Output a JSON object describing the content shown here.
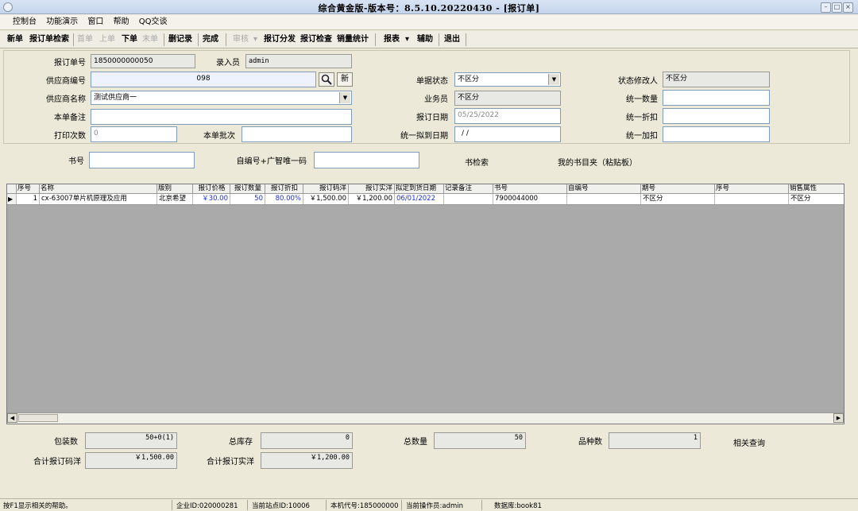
{
  "window": {
    "title": "综合黄金版-版本号：8.5.10.20220430 - [报订单]"
  },
  "menu": [
    "控制台",
    "功能演示",
    "窗口",
    "帮助",
    "QQ交谈"
  ],
  "toolbar": {
    "new": "新单",
    "search": "报订单检索",
    "first": "首单",
    "prev": "上单",
    "next": "下单",
    "last": "末单",
    "delete": "删记录",
    "done": "完成",
    "review": "审核",
    "review_arrow": "▾",
    "distribute": "报订分发",
    "check": "报订检查",
    "sales": "销量统计",
    "report": "报表",
    "report_arrow": "▾",
    "assist": "辅助",
    "exit": "退出"
  },
  "form": {
    "order_no_label": "报订单号",
    "order_no": "1850000000050",
    "entry_label": "录入员",
    "entry": "admin",
    "supplier_code_label": "供应商编号",
    "supplier_code": "098",
    "new_btn": "新",
    "supplier_name_label": "供应商名称",
    "supplier_name": "测试供应商一",
    "remark_label": "本单备注",
    "remark": "",
    "print_label": "打印次数",
    "print": "0",
    "batch_label": "本单批次",
    "batch": "",
    "status_label": "单据状态",
    "status": "不区分",
    "status_mod_label": "状态修改人",
    "status_mod": "不区分",
    "sales_label": "业务员",
    "sales": "不区分",
    "qty_label": "统一数量",
    "qty": "",
    "date_label": "报订日期",
    "date": "05/25/2022",
    "discount_label": "统一折扣",
    "discount": "",
    "plan_date_label": "统一拟到日期",
    "plan_date": "  /  /",
    "markup_label": "统一加扣",
    "markup": "",
    "book_no_label": "书号",
    "book_no": "",
    "code_label": "自编号+广智唯一码",
    "code": "",
    "book_search": "书检索",
    "my_books": "我的书目夹（粘贴板）"
  },
  "grid": {
    "headers": [
      "序号",
      "名称",
      "版别",
      "报订价格",
      "报订数量",
      "报订折扣",
      "报订码洋",
      "报订实洋",
      "拟定到货日期",
      "记录备注",
      "书号",
      "自编号",
      "期号",
      "序号",
      "销售属性"
    ],
    "rows": [
      {
        "marker": "▶",
        "cells": [
          "1",
          "cx-63007单片机原理及应用",
          "北京希望",
          "￥30.00",
          "50",
          "80.00%",
          "￥1,500.00",
          "￥1,200.00",
          "06/01/2022",
          "",
          "7900044000",
          "",
          "不区分",
          "",
          "不区分"
        ]
      }
    ]
  },
  "summary": {
    "pack_label": "包装数",
    "pack": "50+0(1)",
    "stock_label": "总库存",
    "stock": "0",
    "total_qty_label": "总数量",
    "total_qty": "50",
    "kinds_label": "品种数",
    "kinds": "1",
    "related": "相关查询",
    "total_list_label": "合计报订码洋",
    "total_list": "￥1,500.00",
    "total_net_label": "合计报订实洋",
    "total_net": "￥1,200.00"
  },
  "status": {
    "help": "按F1显示相关的帮助。",
    "company": "企业ID:020000281",
    "site": "当前站点ID:10006",
    "machine": "本机代号:185000000",
    "operator": "当前操作员:admin",
    "db": "数据库:book81"
  }
}
